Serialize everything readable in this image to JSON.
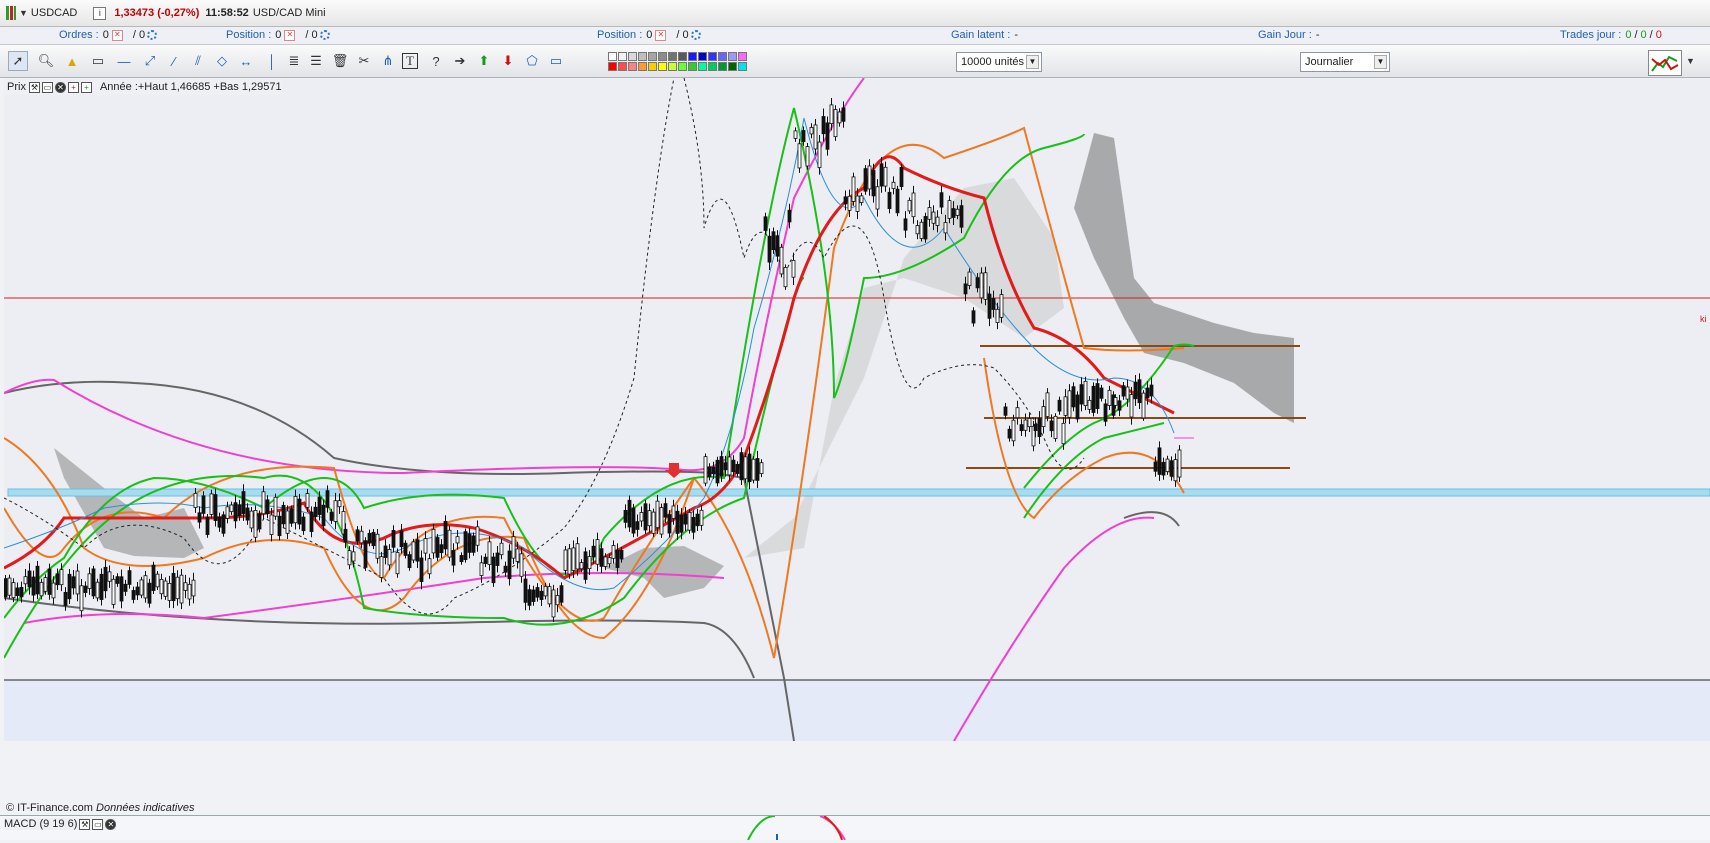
{
  "top_bar": {
    "symbol": "USDCAD",
    "info_label": "i",
    "price_change": "1,33473 (-0,27%)",
    "time": "11:58:52",
    "instrument": "USD/CAD Mini"
  },
  "account_bar": {
    "orders_label": "Ordres :",
    "orders_value": "0",
    "orders_total": "/ 0",
    "position1_label": "Position :",
    "position1_value": "0",
    "position1_total": "/ 0",
    "position2_label": "Position :",
    "position2_value": "0",
    "position2_total": "/ 0",
    "gain_latent_label": "Gain latent :",
    "gain_latent_value": "-",
    "gain_jour_label": "Gain Jour :",
    "gain_jour_value": "-",
    "trades_label": "Trades jour :",
    "trades_a": "0",
    "trades_b": "0",
    "trades_c": "0"
  },
  "toolbar": {
    "units_select": "10000 unités",
    "period_select": "Journalier",
    "palette_colors": [
      "#ffffff",
      "#f2f2f2",
      "#d9d9d9",
      "#bfbfbf",
      "#a6a6a6",
      "#8c8c8c",
      "#737373",
      "#595959",
      "#1a1aff",
      "#0000cc",
      "#3333ff",
      "#6666ff",
      "#9999ff",
      "#ff66ff",
      "#ff0000",
      "#ff4d4d",
      "#ff8080",
      "#ff9933",
      "#ffcc00",
      "#ffff00",
      "#ccff33",
      "#66ff33",
      "#33cc33",
      "#00ff99",
      "#00cc66",
      "#009933",
      "#006600",
      "#00e6e6"
    ]
  },
  "chart": {
    "legend_label": "Prix",
    "range_text": "Année :+Haut 1,46685 +Bas 1,29571",
    "right_label": "ki",
    "credit": "© IT-Finance.com",
    "credit_italic": "Données indicatives",
    "indicator_label": "MACD (9 19 6)",
    "colors": {
      "tenkan": "#e21a1a",
      "kijun_line": "#cc2222",
      "bb_outer": "#f07820",
      "bb_green": "#18c018",
      "ma_blue": "#2a8fd8",
      "ma_magenta": "#f040d0",
      "ma_gray": "#666666",
      "support_band": "#a6dcf0",
      "resistance": "#8a4a14"
    }
  }
}
